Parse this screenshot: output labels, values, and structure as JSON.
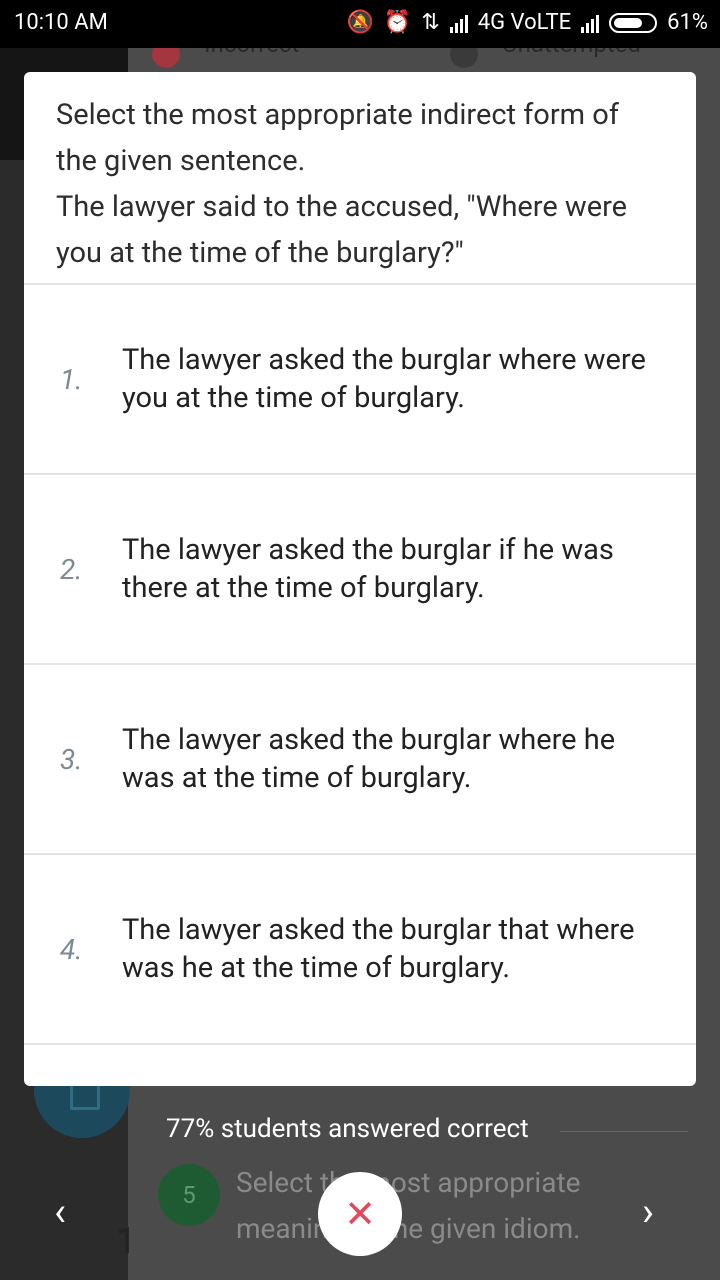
{
  "status_bar": {
    "time": "10:10 AM",
    "network": "4G VoLTE",
    "battery": "61%"
  },
  "background": {
    "legend_incorrect": "Incorrect",
    "legend_unattempted": "Unattempted",
    "stats_text": "77% students answered correct",
    "next_question_number": "5",
    "next_question_text": "Select the most appropriate meaning of the given idiom.",
    "left_partial": "1"
  },
  "dialog": {
    "question_line1": "Select the most appropriate indirect form of the given sentence.",
    "question_line2": "The lawyer said to the accused, \"Where were you at the time of the burglary?\"",
    "options": [
      {
        "num": "1.",
        "text": "The lawyer asked the burglar where were you at the time of burglary."
      },
      {
        "num": "2.",
        "text": "The lawyer asked the burglar if he was there at the time of burglary."
      },
      {
        "num": "3.",
        "text": "The lawyer asked the burglar where he was at the time of burglary."
      },
      {
        "num": "4.",
        "text": "The lawyer asked the burglar that where was he at the time of burglary."
      }
    ]
  },
  "nav": {
    "prev_label": "‹",
    "next_label": "›",
    "close_label": "✕"
  },
  "colors": {
    "close_icon": "#e04a5a",
    "incorrect_dot": "#a3363f",
    "unattempted_dot": "#3a3a3a",
    "qnum_bg": "#1f5b32"
  }
}
